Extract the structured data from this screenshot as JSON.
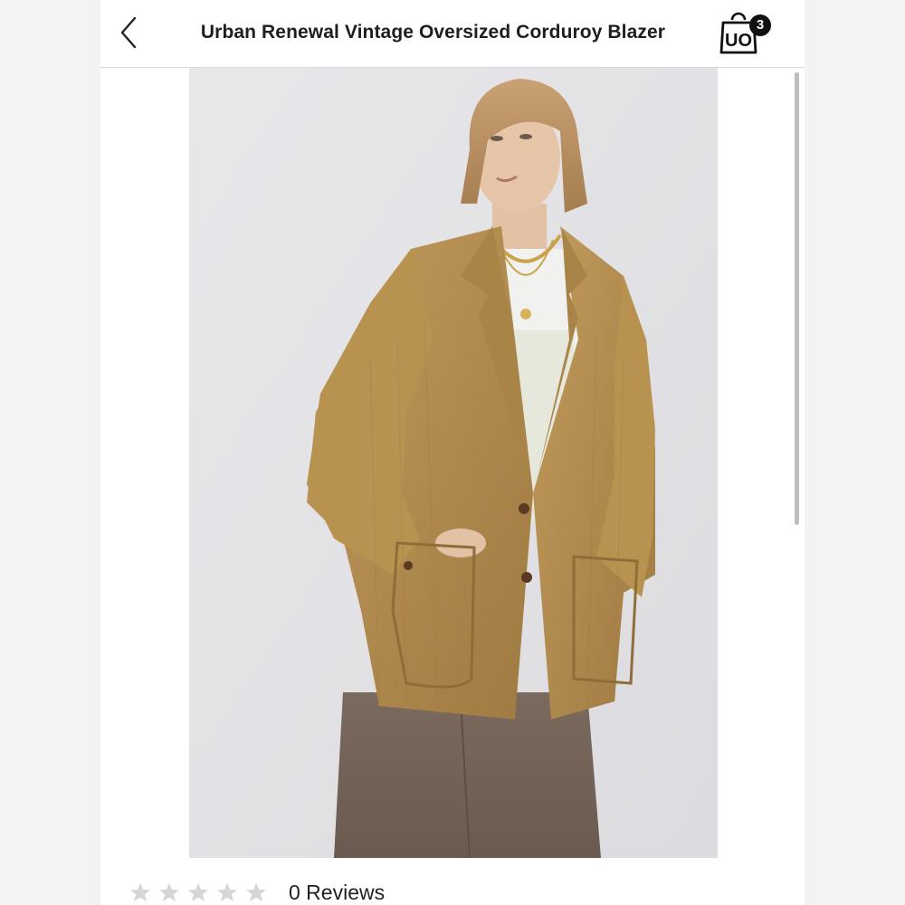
{
  "header": {
    "title": "Urban Renewal Vintage Oversized Corduroy Blazer",
    "back_icon": "chevron-left-icon",
    "bag_icon": "shopping-bag-icon",
    "bag_logo": "UO",
    "bag_count": "3"
  },
  "product": {
    "image_alt": "Model wearing tan corduroy blazer over white tee and lace top with brown denim skirt"
  },
  "rating": {
    "stars_total": 5,
    "stars_filled": 0,
    "star_color_empty": "#d6d6d6",
    "reviews_label": "0 Reviews"
  },
  "colors": {
    "background_side": "#f3f3f3",
    "header_bg": "#ffffff",
    "text_primary": "#1e1e1e",
    "badge_bg": "#111111"
  }
}
